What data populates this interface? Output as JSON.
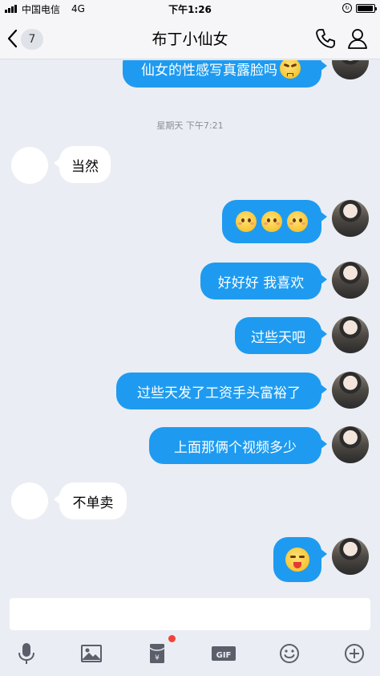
{
  "status_bar": {
    "carrier": "中国电信",
    "network": "4G",
    "time": "下午1:26",
    "battery_level": 0.95
  },
  "nav": {
    "back_count": "7",
    "title": "布丁小仙女",
    "icons": [
      "chevron-left-icon",
      "phone-icon",
      "profile-icon"
    ]
  },
  "chat": {
    "timestamp": "星期天 下午7:21",
    "messages": [
      {
        "side": "out",
        "text": "仙女的性感写真露脸吗",
        "emoji": "sad-face"
      },
      {
        "side": "in",
        "text": "当然"
      },
      {
        "side": "out",
        "text": "",
        "emoji": "smile-face x3"
      },
      {
        "side": "out",
        "text": "好好好 我喜欢"
      },
      {
        "side": "out",
        "text": "过些天吧"
      },
      {
        "side": "out",
        "text": "过些天发了工资手头富裕了"
      },
      {
        "side": "out",
        "text": "上面那俩个视频多少"
      },
      {
        "side": "in",
        "text": "不单卖"
      },
      {
        "side": "out",
        "text": "",
        "emoji": "tongue-face"
      }
    ]
  },
  "input": {
    "placeholder": "",
    "toolbar": [
      "microphone-icon",
      "image-icon",
      "red-packet-icon",
      "gif-icon",
      "emoji-icon",
      "plus-icon"
    ],
    "accent_color": "#1e9bf0",
    "notification_dot_color": "#f0443a"
  }
}
